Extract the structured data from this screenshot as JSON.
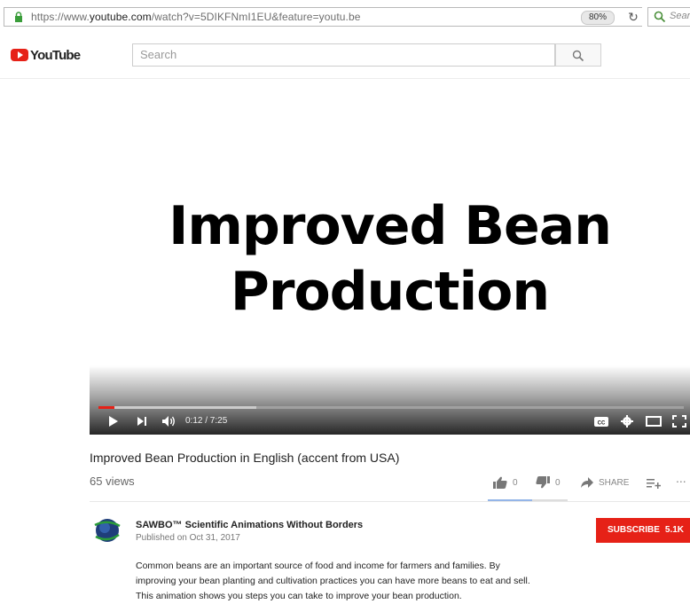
{
  "browser": {
    "url_prefix": "https://www.",
    "url_domain": "youtube.com",
    "url_rest": "/watch?v=5DIKFNmI1EU&feature=youtu.be",
    "zoom": "80%",
    "search_placeholder": "Sear"
  },
  "header": {
    "logo_text": "YouTube",
    "search_placeholder": "Search"
  },
  "player": {
    "title_art_line1": "Improved Bean",
    "title_art_line2": "Production",
    "time": "0:12 / 7:25",
    "played_fraction": 0.027,
    "buffered_fraction": 0.27
  },
  "video": {
    "title": "Improved Bean Production in English (accent from USA)",
    "views": "65 views",
    "likes": "0",
    "dislikes": "0",
    "share_label": "SHARE",
    "more_label": "..."
  },
  "channel": {
    "name": "SAWBO™ Scientific Animations Without Borders",
    "published": "Published on Oct 31, 2017",
    "subscribe_label": "SUBSCRIBE",
    "subscriber_count": "5.1K"
  },
  "description": {
    "lines": [
      "Common beans are an important source of food and income for farmers and families. By",
      "improving your bean planting and cultivation practices you can have more beans to eat and sell.",
      "This animation shows you steps you can take to improve your bean production."
    ]
  },
  "colors": {
    "brand_red": "#e62117",
    "sentiment_blue": "#94b5e8"
  }
}
